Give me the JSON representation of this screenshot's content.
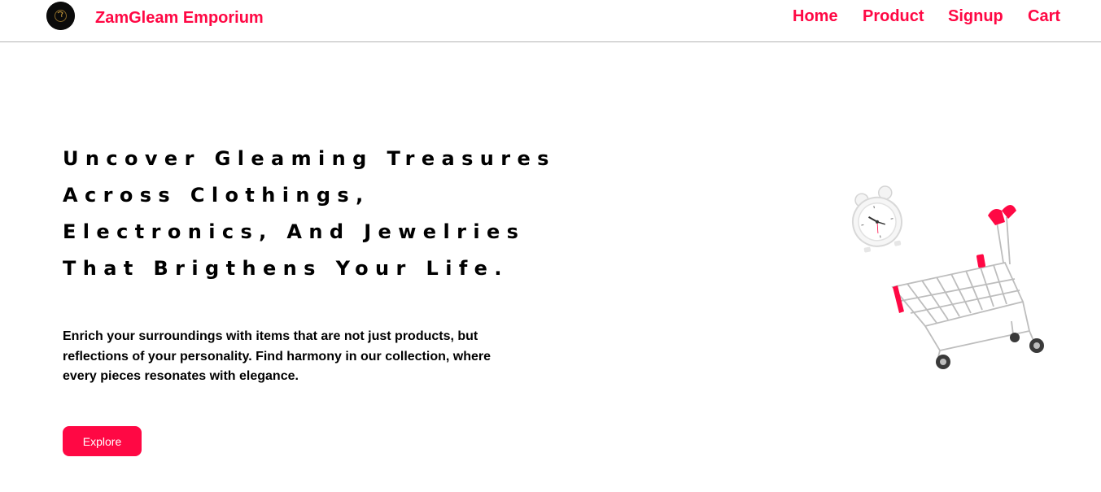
{
  "brand": {
    "name": "ZamGleam Emporium",
    "logo_icon": "brand-logo-icon"
  },
  "nav": {
    "links": [
      {
        "label": "Home"
      },
      {
        "label": "Product"
      },
      {
        "label": "Signup"
      },
      {
        "label": "Cart"
      }
    ]
  },
  "hero": {
    "title_lines": [
      "Uncover Gleaming Treasures",
      "Across Clothings,",
      "Electronics, And Jewelries",
      "That Brigthens Your Life."
    ],
    "description": "Enrich your surroundings with items that are not just products, but reflections of your personality. Find harmony in our collection, where every pieces resonates with elegance.",
    "cta_label": "Explore",
    "illustration_icons": [
      "alarm-clock-icon",
      "shopping-cart-icon"
    ]
  },
  "colors": {
    "accent": "#ff0844",
    "text": "#000000",
    "background": "#ffffff",
    "divider": "#b3b3b3"
  }
}
